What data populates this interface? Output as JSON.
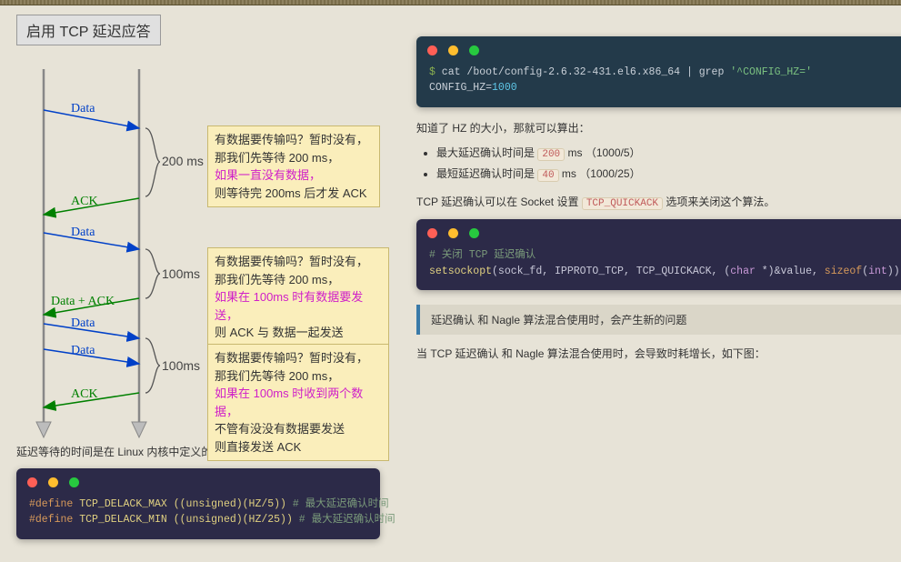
{
  "diagram": {
    "title": "启用 TCP 延迟应答",
    "labels": {
      "data1": "Data",
      "ack1": "ACK",
      "data2": "Data",
      "data_ack": "Data + ACK",
      "data3": "Data",
      "data4": "Data",
      "ack2": "ACK"
    },
    "times": {
      "t1": "200 ms",
      "t2": "100ms",
      "t3": "100ms"
    },
    "note1": {
      "l1": "有数据要传输吗？暂时没有，",
      "l2": "那我们先等待 200 ms，",
      "l3": "如果一直没有数据，",
      "l4": "则等待完 200ms 后才发 ACK"
    },
    "note2": {
      "l1": "有数据要传输吗？暂时没有，",
      "l2": "那我们先等待 200 ms，",
      "l3": "如果在 100ms 时有数据要发送，",
      "l4": "则 ACK 与 数据一起发送"
    },
    "note3": {
      "l1": "有数据要传输吗？暂时没有，",
      "l2": "那我们先等待 200 ms，",
      "l3": "如果在 100ms 时收到两个数据，",
      "l4": "不管有没没有数据要发送",
      "l5": "则直接发送 ACK"
    }
  },
  "left_body": "延迟等待的时间是在 Linux 内核中定义的，如下图：",
  "code1": {
    "l1_head": "#define",
    "l1_name": " TCP_DELACK_MAX ",
    "l1_expr": "((unsigned)(HZ/5))  ",
    "l1_c": "# 最大延迟确认时间",
    "l2_head": "#define",
    "l2_name": " TCP_DELACK_MIN ",
    "l2_expr": "((unsigned)(HZ/25)) ",
    "l2_c": "# 最大延迟确认时间"
  },
  "code_right1": {
    "prompt": "$",
    "cmd": " cat /boot/config-2.6.32-431.el6.x86_64 | grep ",
    "arg": "'^CONFIG_HZ='",
    "line2a": "CONFIG_HZ=",
    "line2b": "1000"
  },
  "right": {
    "p1": "知道了 HZ 的大小，那就可以算出：",
    "li1a": "最大延迟确认时间是 ",
    "li1_code": "200",
    "li1b": " ms （1000/5）",
    "li2a": "最短延迟确认时间是 ",
    "li2_code": "40",
    "li2b": " ms （1000/25）",
    "p2a": "TCP 延迟确认可以在 Socket 设置 ",
    "p2_code": "TCP_QUICKACK",
    "p2b": " 选项来关闭这个算法。",
    "callout": "延迟确认 和 Nagle 算法混合使用时，会产生新的问题",
    "p3": "当 TCP 延迟确认 和 Nagle 算法混合使用时，会导致时耗增长，如下图："
  },
  "code_right2": {
    "c1": "# 关闭 TCP 延迟确认",
    "fn": "setsockopt",
    "arg1": "(sock_fd, IPPROTO_TCP, TCP_QUICKACK, (",
    "kw1": "char",
    "arg2": " *)&value, ",
    "kw2": "sizeof",
    "arg3": "(",
    "kw3": "int",
    "arg4": "));"
  }
}
